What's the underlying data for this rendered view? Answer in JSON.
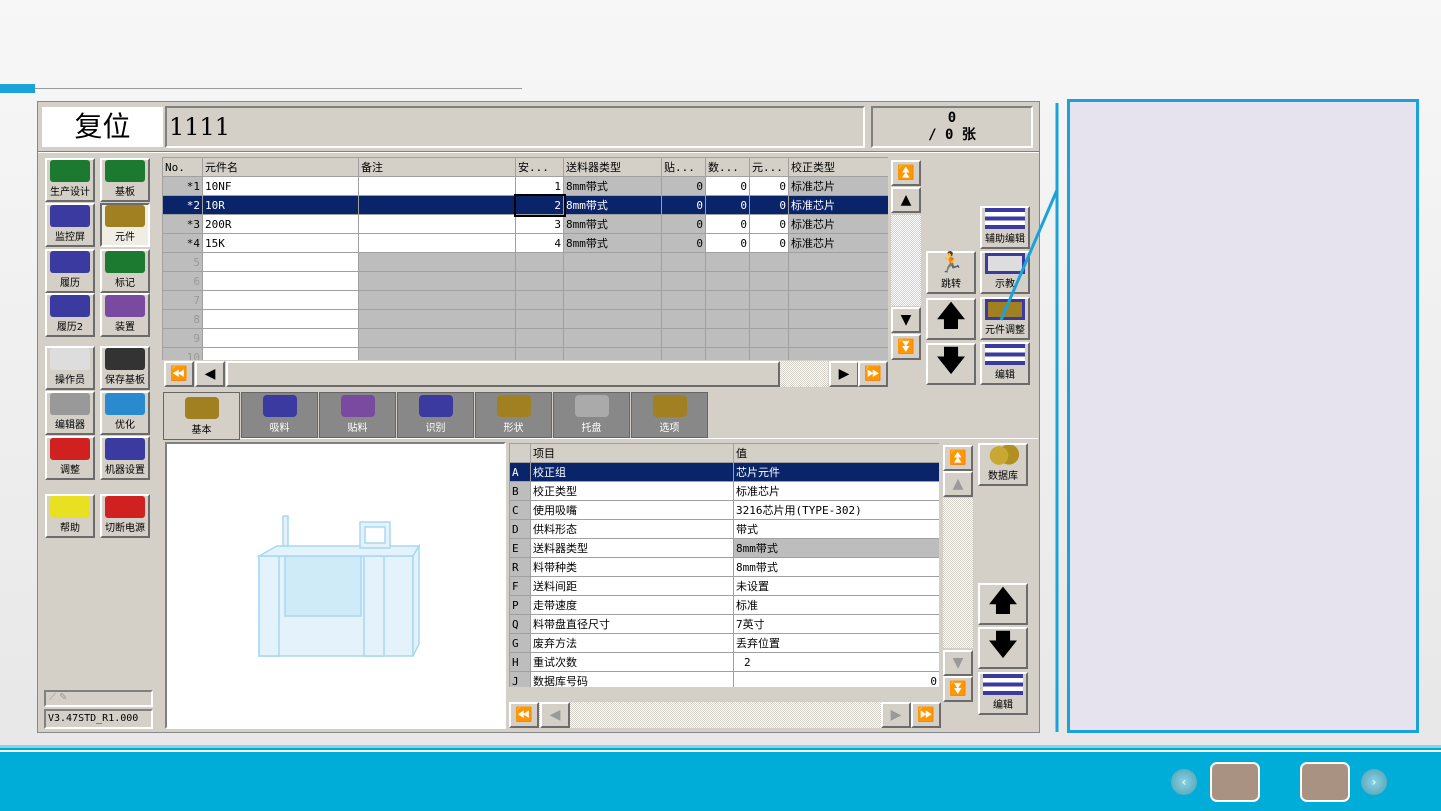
{
  "header": {
    "mode": "复位",
    "program_name": "1111",
    "count_top": "0",
    "count_bottom": "/ 0 张"
  },
  "sidebar": {
    "items": [
      {
        "label": "生产设计",
        "icon": "production-design-icon"
      },
      {
        "label": "基板",
        "icon": "board-icon"
      },
      {
        "label": "监控屏",
        "icon": "monitor-icon"
      },
      {
        "label": "元件",
        "icon": "component-icon"
      },
      {
        "label": "履历",
        "icon": "history-icon"
      },
      {
        "label": "标记",
        "icon": "mark-icon"
      },
      {
        "label": "履历2",
        "icon": "history2-icon"
      },
      {
        "label": "装置",
        "icon": "device-icon"
      },
      {
        "label": "操作员",
        "icon": "operator-icon"
      },
      {
        "label": "保存基板",
        "icon": "save-icon"
      },
      {
        "label": "编辑器",
        "icon": "editor-icon"
      },
      {
        "label": "优化",
        "icon": "optimize-icon"
      },
      {
        "label": "调整",
        "icon": "wrench-icon"
      },
      {
        "label": "机器设置",
        "icon": "machine-settings-icon"
      },
      {
        "label": "帮助",
        "icon": "help-icon"
      },
      {
        "label": "切断电源",
        "icon": "power-icon"
      }
    ],
    "version": "V3.47STD_R1.000"
  },
  "component_table": {
    "columns": [
      "No.",
      "元件名",
      "备注",
      "安...",
      "送料器类型",
      "贴...",
      "数...",
      "元...",
      "校正类型"
    ],
    "rows": [
      {
        "no": "*1",
        "name": "10NF",
        "note": "",
        "mount": "1",
        "feeder": "8mm带式",
        "p": "0",
        "n": "0",
        "e": "0",
        "align": "标准芯片"
      },
      {
        "no": "*2",
        "name": "10R",
        "note": "",
        "mount": "2",
        "feeder": "8mm带式",
        "p": "0",
        "n": "0",
        "e": "0",
        "align": "标准芯片"
      },
      {
        "no": "*3",
        "name": "200R",
        "note": "",
        "mount": "3",
        "feeder": "8mm带式",
        "p": "0",
        "n": "0",
        "e": "0",
        "align": "标准芯片"
      },
      {
        "no": "*4",
        "name": "15K",
        "note": "",
        "mount": "4",
        "feeder": "8mm带式",
        "p": "0",
        "n": "0",
        "e": "0",
        "align": "标准芯片"
      },
      {
        "no": "5"
      },
      {
        "no": "6"
      },
      {
        "no": "7"
      },
      {
        "no": "8"
      },
      {
        "no": "9"
      },
      {
        "no": "10"
      }
    ],
    "selected_row": 2
  },
  "right_buttons": {
    "aux_edit": "辅助编辑",
    "jump": "跳转",
    "teach": "示教",
    "component_adjust": "元件调整",
    "edit": "编辑",
    "database": "数据库",
    "edit2": "编辑"
  },
  "tabs": [
    {
      "label": "基本",
      "selected": true
    },
    {
      "label": "吸料"
    },
    {
      "label": "贴料"
    },
    {
      "label": "识别"
    },
    {
      "label": "形状"
    },
    {
      "label": "托盘"
    },
    {
      "label": "选项"
    }
  ],
  "property_table": {
    "columns": [
      "项目",
      "值"
    ],
    "rows": [
      {
        "key": "A",
        "item": "校正组",
        "value": "芯片元件"
      },
      {
        "key": "B",
        "item": "校正类型",
        "value": "标准芯片"
      },
      {
        "key": "C",
        "item": "使用吸嘴",
        "value": "3216芯片用(TYPE-302)"
      },
      {
        "key": "D",
        "item": "供料形态",
        "value": "带式"
      },
      {
        "key": "E",
        "item": "送料器类型",
        "value": "8mm带式"
      },
      {
        "key": "R",
        "item": "料带种类",
        "value": "8mm带式"
      },
      {
        "key": "F",
        "item": "送料间距",
        "value": "未设置"
      },
      {
        "key": "P",
        "item": "走带速度",
        "value": "标准"
      },
      {
        "key": "Q",
        "item": "料带盘直径尺寸",
        "value": "7英寸"
      },
      {
        "key": "G",
        "item": "废弃方法",
        "value": "丢弃位置"
      },
      {
        "key": "H",
        "item": "重试次数",
        "value": "2"
      },
      {
        "key": "J",
        "item": "数据库号码",
        "value": "0"
      }
    ],
    "selected_row": "A"
  },
  "colors": {
    "accent": "#00acd8",
    "selection": "#0a246a",
    "panel": "#d4d0c8",
    "note_panel": "#e6e2ee"
  }
}
